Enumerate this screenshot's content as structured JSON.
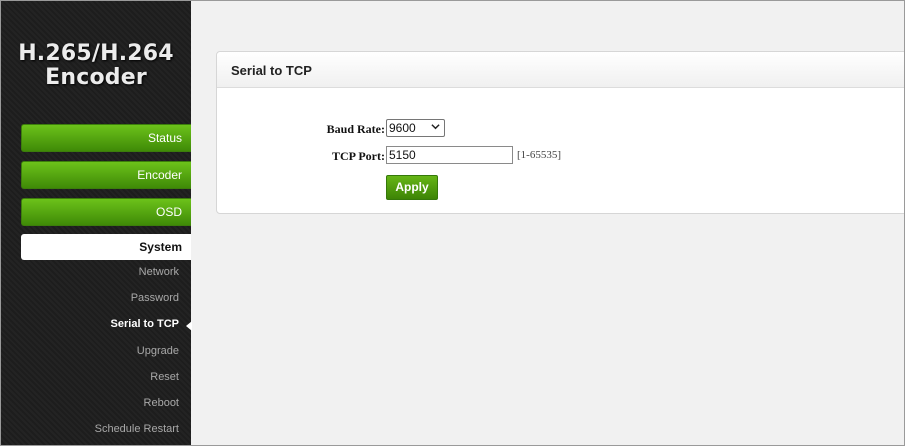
{
  "sidebar": {
    "brand_line1": "H.265/H.264",
    "brand_line2": "Encoder",
    "menu": {
      "status": "Status",
      "encoder": "Encoder",
      "osd": "OSD",
      "system": "System"
    },
    "system_items": {
      "network": "Network",
      "password": "Password",
      "serial_to_tcp": "Serial to TCP",
      "upgrade": "Upgrade",
      "reset": "Reset",
      "reboot": "Reboot",
      "schedule_restart": "Schedule Restart"
    },
    "active_item": "Serial to TCP"
  },
  "panel": {
    "title": "Serial to TCP",
    "baud_rate_label": "Baud Rate:",
    "baud_rate_value": "9600",
    "tcp_port_label": "TCP Port:",
    "tcp_port_value": "5150",
    "tcp_port_range": "[1-65535]",
    "apply_label": "Apply"
  },
  "colors": {
    "accent_green": "#4c9e0c",
    "sidebar_bg": "#1e1e1e"
  }
}
